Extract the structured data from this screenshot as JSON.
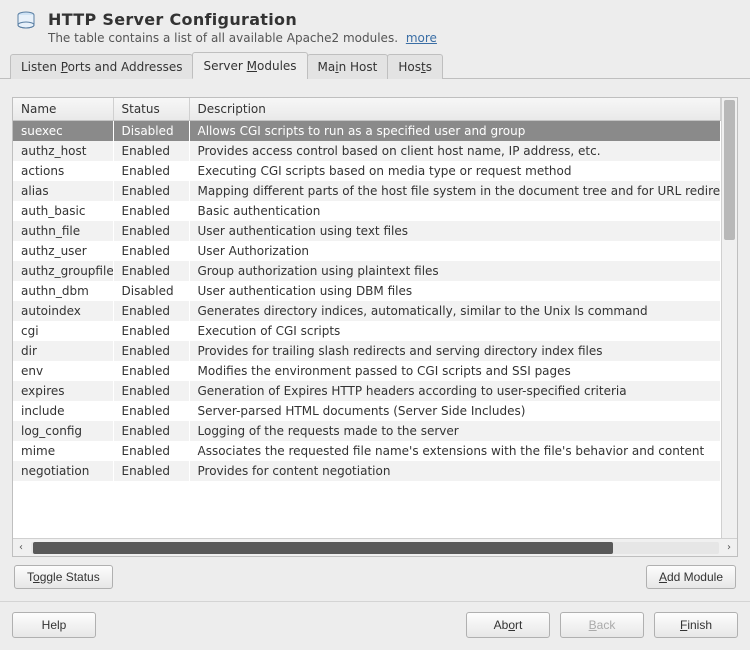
{
  "header": {
    "title": "HTTP Server Configuration",
    "subtitle": "The table contains a list of all available Apache2 modules.",
    "more": "more"
  },
  "tabs": [
    {
      "label_pre": "Listen ",
      "u": "P",
      "label_post": "orts and Addresses",
      "active": false
    },
    {
      "label_pre": "Server ",
      "u": "M",
      "label_post": "odules",
      "active": true
    },
    {
      "label_pre": "Ma",
      "u": "i",
      "label_post": "n Host",
      "active": false
    },
    {
      "label_pre": "Hos",
      "u": "t",
      "label_post": "s",
      "active": false
    }
  ],
  "columns": {
    "name": "Name",
    "status": "Status",
    "description": "Description"
  },
  "rows": [
    {
      "name": "suexec",
      "status": "Disabled",
      "desc": "Allows CGI scripts to run as a specified user and group",
      "selected": true
    },
    {
      "name": "authz_host",
      "status": "Enabled",
      "desc": "Provides access control based on client host name, IP address, etc."
    },
    {
      "name": "actions",
      "status": "Enabled",
      "desc": "Executing CGI scripts based on media type or request method"
    },
    {
      "name": "alias",
      "status": "Enabled",
      "desc": "Mapping different parts of the host file system in the document tree and for URL redirect"
    },
    {
      "name": "auth_basic",
      "status": "Enabled",
      "desc": "Basic authentication"
    },
    {
      "name": "authn_file",
      "status": "Enabled",
      "desc": "User authentication using text files"
    },
    {
      "name": "authz_user",
      "status": "Enabled",
      "desc": "User Authorization"
    },
    {
      "name": "authz_groupfile",
      "status": "Enabled",
      "desc": "Group authorization using plaintext files"
    },
    {
      "name": "authn_dbm",
      "status": "Disabled",
      "desc": "User authentication using DBM files"
    },
    {
      "name": "autoindex",
      "status": "Enabled",
      "desc": "Generates directory indices, automatically, similar to the Unix ls command"
    },
    {
      "name": "cgi",
      "status": "Enabled",
      "desc": "Execution of CGI scripts"
    },
    {
      "name": "dir",
      "status": "Enabled",
      "desc": "Provides for trailing slash redirects and serving directory index files"
    },
    {
      "name": "env",
      "status": "Enabled",
      "desc": "Modifies the environment passed to CGI scripts and SSI pages"
    },
    {
      "name": "expires",
      "status": "Enabled",
      "desc": "Generation of Expires HTTP headers according to user-specified criteria"
    },
    {
      "name": "include",
      "status": "Enabled",
      "desc": "Server-parsed HTML documents (Server Side Includes)"
    },
    {
      "name": "log_config",
      "status": "Enabled",
      "desc": "Logging of the requests made to the server"
    },
    {
      "name": "mime",
      "status": "Enabled",
      "desc": "Associates the requested file name's extensions with the file's behavior and content"
    },
    {
      "name": "negotiation",
      "status": "Enabled",
      "desc": "Provides for content negotiation"
    }
  ],
  "buttons": {
    "toggle_pre": "T",
    "toggle_u": "o",
    "toggle_post": "ggle Status",
    "add_pre": "",
    "add_u": "A",
    "add_post": "dd Module"
  },
  "footer": {
    "help": "Help",
    "abort_pre": "Ab",
    "abort_u": "o",
    "abort_post": "rt",
    "back_pre": "",
    "back_u": "B",
    "back_post": "ack",
    "finish_pre": "",
    "finish_u": "F",
    "finish_post": "inish"
  }
}
